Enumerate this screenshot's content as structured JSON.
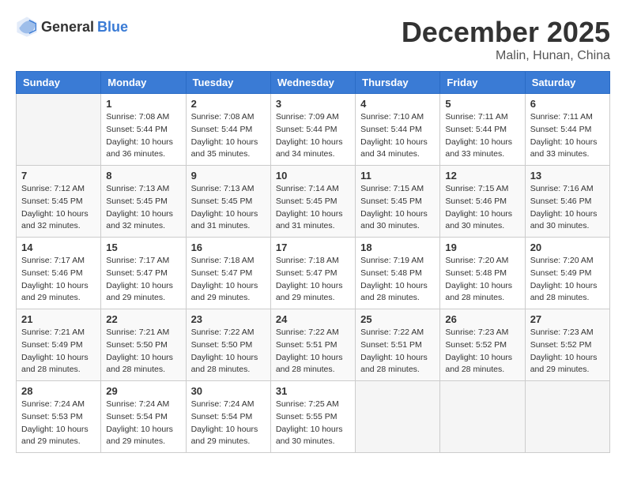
{
  "header": {
    "logo_general": "General",
    "logo_blue": "Blue",
    "month": "December 2025",
    "location": "Malin, Hunan, China"
  },
  "weekdays": [
    "Sunday",
    "Monday",
    "Tuesday",
    "Wednesday",
    "Thursday",
    "Friday",
    "Saturday"
  ],
  "weeks": [
    [
      {
        "day": "",
        "sunrise": "",
        "sunset": "",
        "daylight": ""
      },
      {
        "day": "1",
        "sunrise": "Sunrise: 7:08 AM",
        "sunset": "Sunset: 5:44 PM",
        "daylight": "Daylight: 10 hours and 36 minutes."
      },
      {
        "day": "2",
        "sunrise": "Sunrise: 7:08 AM",
        "sunset": "Sunset: 5:44 PM",
        "daylight": "Daylight: 10 hours and 35 minutes."
      },
      {
        "day": "3",
        "sunrise": "Sunrise: 7:09 AM",
        "sunset": "Sunset: 5:44 PM",
        "daylight": "Daylight: 10 hours and 34 minutes."
      },
      {
        "day": "4",
        "sunrise": "Sunrise: 7:10 AM",
        "sunset": "Sunset: 5:44 PM",
        "daylight": "Daylight: 10 hours and 34 minutes."
      },
      {
        "day": "5",
        "sunrise": "Sunrise: 7:11 AM",
        "sunset": "Sunset: 5:44 PM",
        "daylight": "Daylight: 10 hours and 33 minutes."
      },
      {
        "day": "6",
        "sunrise": "Sunrise: 7:11 AM",
        "sunset": "Sunset: 5:44 PM",
        "daylight": "Daylight: 10 hours and 33 minutes."
      }
    ],
    [
      {
        "day": "7",
        "sunrise": "Sunrise: 7:12 AM",
        "sunset": "Sunset: 5:45 PM",
        "daylight": "Daylight: 10 hours and 32 minutes."
      },
      {
        "day": "8",
        "sunrise": "Sunrise: 7:13 AM",
        "sunset": "Sunset: 5:45 PM",
        "daylight": "Daylight: 10 hours and 32 minutes."
      },
      {
        "day": "9",
        "sunrise": "Sunrise: 7:13 AM",
        "sunset": "Sunset: 5:45 PM",
        "daylight": "Daylight: 10 hours and 31 minutes."
      },
      {
        "day": "10",
        "sunrise": "Sunrise: 7:14 AM",
        "sunset": "Sunset: 5:45 PM",
        "daylight": "Daylight: 10 hours and 31 minutes."
      },
      {
        "day": "11",
        "sunrise": "Sunrise: 7:15 AM",
        "sunset": "Sunset: 5:45 PM",
        "daylight": "Daylight: 10 hours and 30 minutes."
      },
      {
        "day": "12",
        "sunrise": "Sunrise: 7:15 AM",
        "sunset": "Sunset: 5:46 PM",
        "daylight": "Daylight: 10 hours and 30 minutes."
      },
      {
        "day": "13",
        "sunrise": "Sunrise: 7:16 AM",
        "sunset": "Sunset: 5:46 PM",
        "daylight": "Daylight: 10 hours and 30 minutes."
      }
    ],
    [
      {
        "day": "14",
        "sunrise": "Sunrise: 7:17 AM",
        "sunset": "Sunset: 5:46 PM",
        "daylight": "Daylight: 10 hours and 29 minutes."
      },
      {
        "day": "15",
        "sunrise": "Sunrise: 7:17 AM",
        "sunset": "Sunset: 5:47 PM",
        "daylight": "Daylight: 10 hours and 29 minutes."
      },
      {
        "day": "16",
        "sunrise": "Sunrise: 7:18 AM",
        "sunset": "Sunset: 5:47 PM",
        "daylight": "Daylight: 10 hours and 29 minutes."
      },
      {
        "day": "17",
        "sunrise": "Sunrise: 7:18 AM",
        "sunset": "Sunset: 5:47 PM",
        "daylight": "Daylight: 10 hours and 29 minutes."
      },
      {
        "day": "18",
        "sunrise": "Sunrise: 7:19 AM",
        "sunset": "Sunset: 5:48 PM",
        "daylight": "Daylight: 10 hours and 28 minutes."
      },
      {
        "day": "19",
        "sunrise": "Sunrise: 7:20 AM",
        "sunset": "Sunset: 5:48 PM",
        "daylight": "Daylight: 10 hours and 28 minutes."
      },
      {
        "day": "20",
        "sunrise": "Sunrise: 7:20 AM",
        "sunset": "Sunset: 5:49 PM",
        "daylight": "Daylight: 10 hours and 28 minutes."
      }
    ],
    [
      {
        "day": "21",
        "sunrise": "Sunrise: 7:21 AM",
        "sunset": "Sunset: 5:49 PM",
        "daylight": "Daylight: 10 hours and 28 minutes."
      },
      {
        "day": "22",
        "sunrise": "Sunrise: 7:21 AM",
        "sunset": "Sunset: 5:50 PM",
        "daylight": "Daylight: 10 hours and 28 minutes."
      },
      {
        "day": "23",
        "sunrise": "Sunrise: 7:22 AM",
        "sunset": "Sunset: 5:50 PM",
        "daylight": "Daylight: 10 hours and 28 minutes."
      },
      {
        "day": "24",
        "sunrise": "Sunrise: 7:22 AM",
        "sunset": "Sunset: 5:51 PM",
        "daylight": "Daylight: 10 hours and 28 minutes."
      },
      {
        "day": "25",
        "sunrise": "Sunrise: 7:22 AM",
        "sunset": "Sunset: 5:51 PM",
        "daylight": "Daylight: 10 hours and 28 minutes."
      },
      {
        "day": "26",
        "sunrise": "Sunrise: 7:23 AM",
        "sunset": "Sunset: 5:52 PM",
        "daylight": "Daylight: 10 hours and 28 minutes."
      },
      {
        "day": "27",
        "sunrise": "Sunrise: 7:23 AM",
        "sunset": "Sunset: 5:52 PM",
        "daylight": "Daylight: 10 hours and 29 minutes."
      }
    ],
    [
      {
        "day": "28",
        "sunrise": "Sunrise: 7:24 AM",
        "sunset": "Sunset: 5:53 PM",
        "daylight": "Daylight: 10 hours and 29 minutes."
      },
      {
        "day": "29",
        "sunrise": "Sunrise: 7:24 AM",
        "sunset": "Sunset: 5:54 PM",
        "daylight": "Daylight: 10 hours and 29 minutes."
      },
      {
        "day": "30",
        "sunrise": "Sunrise: 7:24 AM",
        "sunset": "Sunset: 5:54 PM",
        "daylight": "Daylight: 10 hours and 29 minutes."
      },
      {
        "day": "31",
        "sunrise": "Sunrise: 7:25 AM",
        "sunset": "Sunset: 5:55 PM",
        "daylight": "Daylight: 10 hours and 30 minutes."
      },
      {
        "day": "",
        "sunrise": "",
        "sunset": "",
        "daylight": ""
      },
      {
        "day": "",
        "sunrise": "",
        "sunset": "",
        "daylight": ""
      },
      {
        "day": "",
        "sunrise": "",
        "sunset": "",
        "daylight": ""
      }
    ]
  ]
}
